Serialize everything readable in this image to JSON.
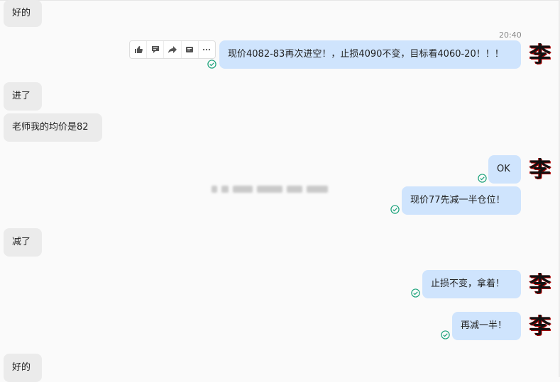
{
  "messages": {
    "m1": "好的",
    "m2": "现价4082-83再次进空！，止损4090不变，目标看4060-20！！！",
    "m2_time": "20:40",
    "m3": "进了",
    "m4": "老师我的均价是82",
    "m5": "OK",
    "m6": "现价77先减一半仓位！",
    "m7": "减了",
    "m8": "止损不变，拿着！",
    "m9": "再减一半！",
    "m10": "好的"
  },
  "avatar_char": "李",
  "toolbar": [
    "thumbs-up-icon",
    "comment-icon",
    "forward-icon",
    "quote-icon",
    "more-icon"
  ],
  "colors": {
    "bubble_out": "#cfe4fd",
    "bubble_in": "#ebebeb",
    "read_check": "#1aa27a"
  }
}
